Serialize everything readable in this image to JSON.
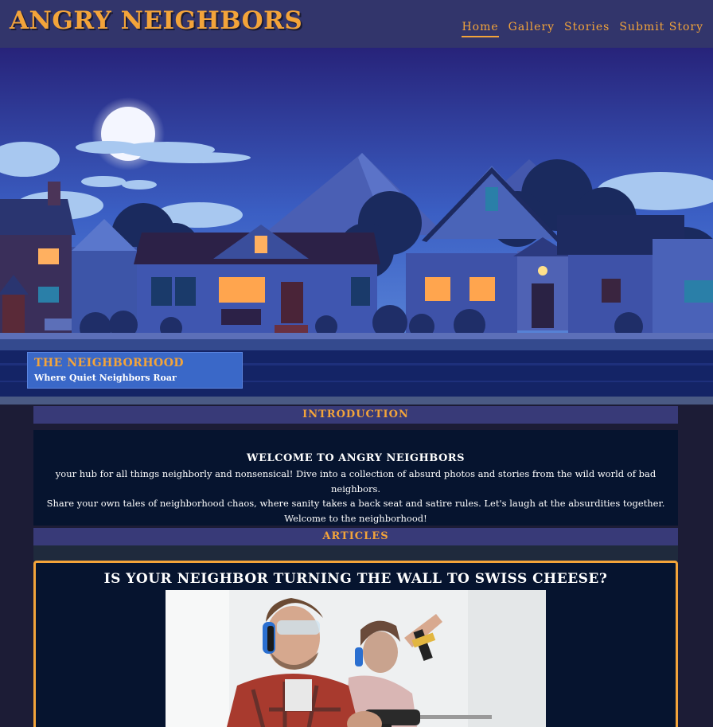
{
  "site": {
    "logo": "ANGRY NEIGHBORS",
    "colors": {
      "header_bg": "#32356b",
      "accent": "#f3a43a",
      "card_bg": "#06142f",
      "section_bar": "#383a78"
    }
  },
  "nav": {
    "items": [
      {
        "label": "Home",
        "active": true
      },
      {
        "label": "Gallery",
        "active": false
      },
      {
        "label": "Stories",
        "active": false
      },
      {
        "label": "Submit Story",
        "active": false
      }
    ]
  },
  "hero": {
    "caption_title": "THE NEIGHBORHOOD",
    "caption_subtitle": "Where Quiet Neighbors Roar"
  },
  "introduction": {
    "section_label": "INTRODUCTION",
    "title": "WELCOME TO ANGRY NEIGHBORS",
    "lines": [
      "your hub for all things neighborly and nonsensical! Dive into a collection of absurd photos and stories from the wild world of bad neighbors.",
      "Share your own tales of neighborhood chaos, where sanity takes a back seat and satire rules. Let's laugh at the absurdities together.",
      "Welcome to the neighborhood!"
    ]
  },
  "articles": {
    "section_label": "ARTICLES",
    "items": [
      {
        "title": "IS YOUR NEIGHBOR TURNING THE WALL TO SWISS CHEESE?"
      }
    ]
  }
}
